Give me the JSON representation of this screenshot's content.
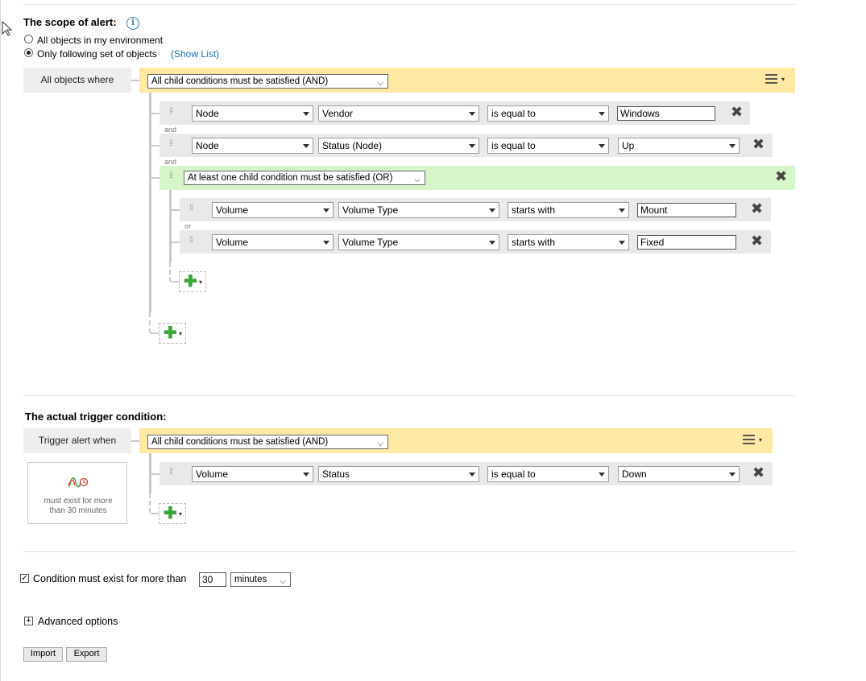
{
  "scope": {
    "title": "The scope of alert:",
    "info_glyph": "i",
    "option_all": "All objects in my environment",
    "option_following": "Only following set of objects",
    "show_list": "(Show List)",
    "root_label": "All objects where",
    "root_mode": "All child conditions must be satisfied (AND)",
    "conditions": [
      {
        "object": "Node",
        "field": "Vendor",
        "operator": "is equal to",
        "value": "Windows"
      },
      {
        "object": "Node",
        "field": "Status (Node)",
        "operator": "is equal to",
        "value": "Up"
      }
    ],
    "connector_and": "and",
    "connector_or": "or",
    "group_mode": "At least one child condition must be satisfied (OR)",
    "group_conditions": [
      {
        "object": "Volume",
        "field": "Volume Type",
        "operator": "starts with",
        "value": "Mount"
      },
      {
        "object": "Volume",
        "field": "Volume Type",
        "operator": "starts with",
        "value": "Fixed"
      }
    ]
  },
  "trigger": {
    "title": "The actual trigger condition:",
    "root_label": "Trigger alert when",
    "root_mode": "All child conditions must be satisfied (AND)",
    "condition": {
      "object": "Volume",
      "field": "Status",
      "operator": "is equal to",
      "value": "Down"
    },
    "duration_text": "must exist for more than 30 minutes"
  },
  "footer": {
    "condition_label": "Condition must exist for more than",
    "duration_value": "30",
    "duration_unit": "minutes",
    "advanced": "Advanced options",
    "import": "Import",
    "export": "Export"
  },
  "icons": {
    "remove": "✖",
    "plus": "✚",
    "caret": "▾",
    "chevron": "⌵",
    "grip": "⁞⁞",
    "check": "✓",
    "expand": "+"
  }
}
